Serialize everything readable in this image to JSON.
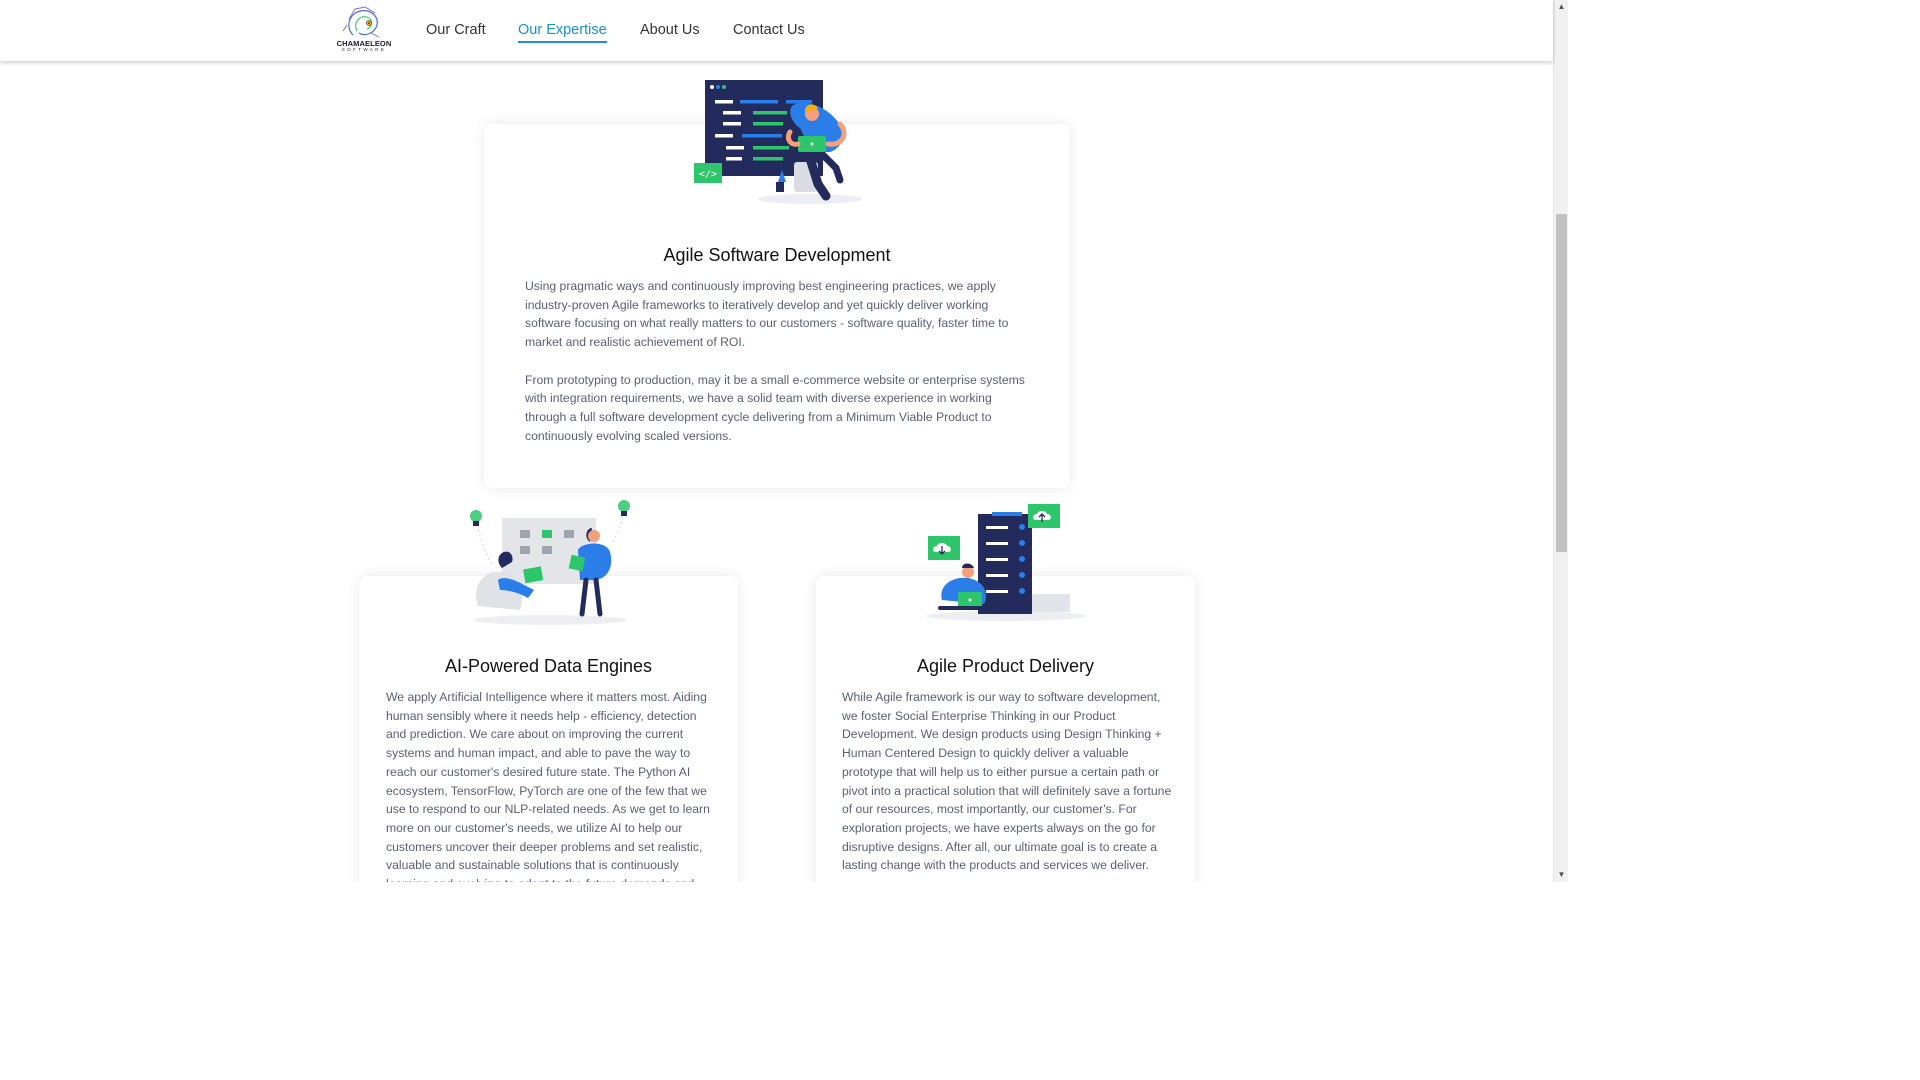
{
  "brand": {
    "name": "CHAMAELEON",
    "sub": "SOFTWARE"
  },
  "nav": {
    "items": [
      {
        "label": "Our Craft"
      },
      {
        "label": "Our Expertise",
        "active": true
      },
      {
        "label": "About Us"
      },
      {
        "label": "Contact Us"
      }
    ]
  },
  "cards": {
    "agile_dev": {
      "title": "Agile Software Development",
      "p1": "Using pragmatic ways and continuously improving best engineering practices, we apply industry-proven Agile frameworks to iteratively develop and yet quickly deliver working software focusing on what really matters to our customers - software quality, faster time to market and realistic achievement of ROI.",
      "p2": "From prototyping to production, may it be a small e-commerce website or enterprise systems with integration requirements, we have a solid team with diverse experience in working through a full software development cycle delivering from a Minimum Viable Product to continuously evolving scaled versions."
    },
    "ai_engines": {
      "title": "AI-Powered Data Engines",
      "text": "We apply Artificial Intelligence where it matters most. Aiding human sensibly where it needs help - efficiency, detection and prediction. We care about on improving the current systems and human impact, and able to pave the way to reach our customer's desired future state. The Python AI ecosystem, TensorFlow, PyTorch are one of the few that we use to respond to our NLP-related needs. As we get to learn more on our customer's needs, we utilize AI to help our customers uncover their deeper problems and set realistic, valuable and sustainable solutions that is continuously learning and evolving to adapt to the future demands and ..."
    },
    "product_delivery": {
      "title": "Agile Product Delivery",
      "text": "While Agile framework is our way to software development, we foster Social Enterprise Thinking in our Product Development. We design products using Design Thinking + Human Centered Design to quickly deliver a valuable prototype that will help us to either pursue a certain path or pivot into a practical solution that will definitely save a fortune of our resources, most importantly, our customer's. For exploration projects, we have experts always on the go for disruptive designs. After all, our ultimate goal is to create a lasting change with the products and services we deliver."
    }
  },
  "colors": {
    "accent": "#1a8fd1",
    "navy": "#232a5c",
    "green": "#2ec66b",
    "blue": "#2b7de9"
  },
  "icons": {
    "code_badge": "</>",
    "scroll_up": "▲",
    "scroll_down": "▼"
  }
}
